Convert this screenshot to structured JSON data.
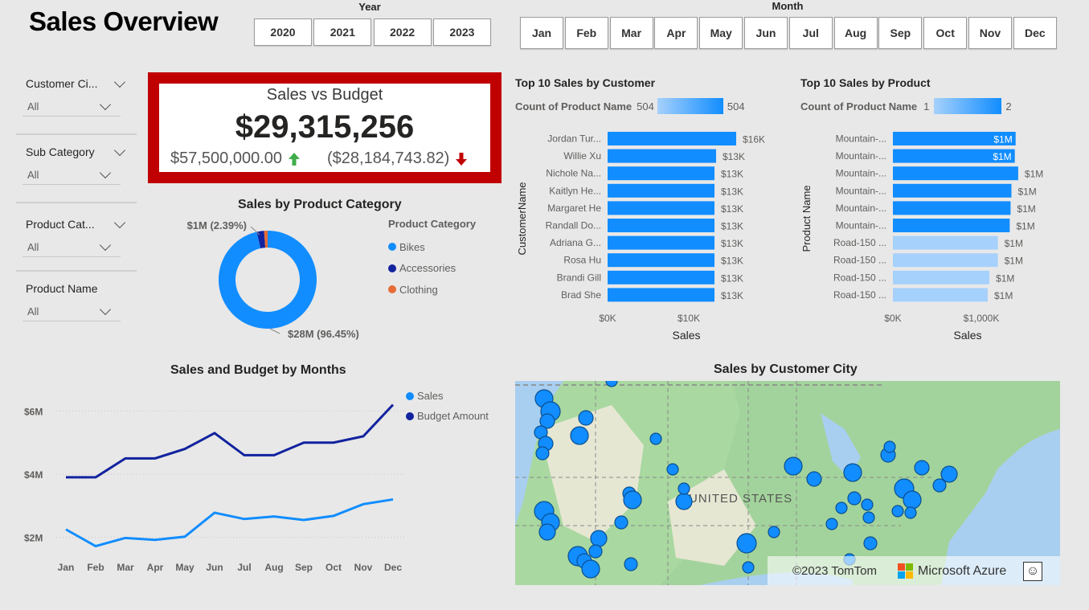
{
  "page_title": "Sales Overview",
  "year_slicer": {
    "title": "Year",
    "options": [
      "2020",
      "2021",
      "2022",
      "2023"
    ]
  },
  "month_slicer": {
    "title": "Month",
    "options": [
      "Jan",
      "Feb",
      "Mar",
      "Apr",
      "May",
      "Jun",
      "Jul",
      "Aug",
      "Sep",
      "Oct",
      "Nov",
      "Dec"
    ]
  },
  "filters": [
    {
      "title": "Customer Ci...",
      "value": "All"
    },
    {
      "title": "Sub Category",
      "value": "All"
    },
    {
      "title": "Product Cat...",
      "value": "All"
    },
    {
      "title": "Product Name",
      "value": "All"
    }
  ],
  "kpi": {
    "title": "Sales vs Budget",
    "value": "$29,315,256",
    "budget": "$57,500,000.00",
    "variance": "($28,184,743.82)",
    "colors": {
      "border": "#c00000",
      "up_arrow": "#3fae49",
      "down_arrow": "#c00000"
    }
  },
  "icons": [
    "arrow-up-icon",
    "arrow-down-icon",
    "chevron-down-icon",
    "microsoft-logo-icon",
    "smiley-feedback-icon"
  ],
  "chart_data": [
    {
      "id": "donut",
      "type": "pie",
      "title": "Sales by Product Category",
      "legend_title": "Product Category",
      "legend_position": "right",
      "categories": [
        "Bikes",
        "Accessories",
        "Clothing"
      ],
      "values": [
        96.45,
        2.39,
        1.16
      ],
      "colors": [
        "#118dff",
        "#12239e",
        "#e66c37"
      ],
      "labels": [
        "$28M (96.45%)",
        "$1M (2.39%)"
      ]
    },
    {
      "id": "customers",
      "type": "bar",
      "title": "Top 10 Sales by Customer",
      "gradient_legend": {
        "label": "Count of Product Name",
        "min": "504",
        "max": "504"
      },
      "ylabel": "CustomerName",
      "xlabel": "Sales",
      "categories": [
        "Jordan Tur...",
        "Willie Xu",
        "Nichole Na...",
        "Kaitlyn He...",
        "Margaret He",
        "Randall Do...",
        "Adriana G...",
        "Rosa Hu",
        "Brandi Gill",
        "Brad She"
      ],
      "values": [
        16000,
        13500,
        13300,
        13300,
        13300,
        13300,
        13300,
        13300,
        13300,
        13300
      ],
      "value_labels": [
        "$16K",
        "$13K",
        "$13K",
        "$13K",
        "$13K",
        "$13K",
        "$13K",
        "$13K",
        "$13K",
        "$13K"
      ],
      "xticks": [
        "$0K",
        "$10K"
      ],
      "xlim": [
        0,
        16000
      ],
      "bar_colors": [
        "#118dff"
      ]
    },
    {
      "id": "products",
      "type": "bar",
      "title": "Top 10 Sales by Product",
      "gradient_legend": {
        "label": "Count of Product Name",
        "min": "1",
        "max": "2"
      },
      "ylabel": "Product Name",
      "xlabel": "Sales",
      "categories": [
        "Mountain-...",
        "Mountain-...",
        "Mountain-...",
        "Mountain-...",
        "Mountain-...",
        "Mountain-...",
        "Road-150 ...",
        "Road-150 ...",
        "Road-150 ...",
        "Road-150 ..."
      ],
      "values": [
        1450000,
        1440000,
        1480000,
        1400000,
        1390000,
        1380000,
        1240000,
        1240000,
        1140000,
        1120000
      ],
      "value_labels": [
        "$1M",
        "$1M",
        "$1M",
        "$1M",
        "$1M",
        "$1M",
        "$1M",
        "$1M",
        "$1M",
        "$1M"
      ],
      "xticks": [
        "$0K",
        "$1,000K"
      ],
      "xlim": [
        0,
        1500000
      ],
      "bar_colors": [
        "#118dff",
        "#118dff",
        "#118dff",
        "#118dff",
        "#118dff",
        "#118dff",
        "#a6d1fc",
        "#a6d1fc",
        "#a6d1fc",
        "#a6d1fc"
      ]
    },
    {
      "id": "months",
      "type": "line",
      "title": "Sales and Budget by Months",
      "legend_position": "right",
      "categories": [
        "Jan",
        "Feb",
        "Mar",
        "Apr",
        "May",
        "Jun",
        "Jul",
        "Aug",
        "Sep",
        "Oct",
        "Nov",
        "Dec"
      ],
      "series": [
        {
          "name": "Sales",
          "color": "#118dff",
          "values": [
            2.25,
            1.72,
            1.98,
            1.92,
            2.02,
            2.78,
            2.58,
            2.66,
            2.55,
            2.68,
            3.05,
            3.2
          ]
        },
        {
          "name": "Budget Amount",
          "color": "#12239e",
          "values": [
            3.9,
            3.9,
            4.5,
            4.5,
            4.8,
            5.3,
            4.6,
            4.6,
            5.0,
            5.0,
            5.2,
            6.2
          ]
        }
      ],
      "yticks": [
        "$2M",
        "$4M",
        "$6M"
      ],
      "ylim": [
        1.2,
        6.8
      ],
      "grid": true
    }
  ],
  "map": {
    "title": "Sales by Customer City",
    "country_label": "UNITED STATES",
    "attribution": "©2023 TomTom",
    "provider": "Microsoft Azure"
  }
}
